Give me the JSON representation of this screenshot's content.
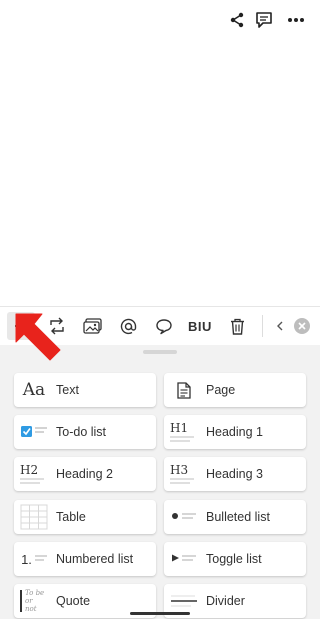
{
  "topbar": {
    "icons": [
      "share-icon",
      "comment-icon",
      "more-icon"
    ]
  },
  "toolbar": {
    "items": [
      "plus-icon",
      "turn-into-icon",
      "image-icon",
      "mention-icon",
      "comment-icon",
      "format-icon",
      "trash-icon",
      "chevron-left-icon",
      "close-icon"
    ],
    "format_label": "BIU"
  },
  "blocks": {
    "left": [
      {
        "label": "Text",
        "icon": "text-icon",
        "glyph": "Aa"
      },
      {
        "label": "To-do list",
        "icon": "todo-icon"
      },
      {
        "label": "Heading 2",
        "icon": "heading2-icon",
        "glyph": "H2"
      },
      {
        "label": "Table",
        "icon": "table-icon"
      },
      {
        "label": "Numbered list",
        "icon": "numbered-list-icon",
        "glyph": "1."
      },
      {
        "label": "Quote",
        "icon": "quote-icon",
        "glyph": "To be or not"
      }
    ],
    "right": [
      {
        "label": "Page",
        "icon": "page-icon"
      },
      {
        "label": "Heading 1",
        "icon": "heading1-icon",
        "glyph": "H1"
      },
      {
        "label": "Heading 3",
        "icon": "heading3-icon",
        "glyph": "H3"
      },
      {
        "label": "Bulleted list",
        "icon": "bulleted-list-icon"
      },
      {
        "label": "Toggle list",
        "icon": "toggle-list-icon"
      },
      {
        "label": "Divider",
        "icon": "divider-icon"
      }
    ]
  },
  "colors": {
    "accent_red": "#e8231c",
    "checkbox_blue": "#2f9be3"
  }
}
